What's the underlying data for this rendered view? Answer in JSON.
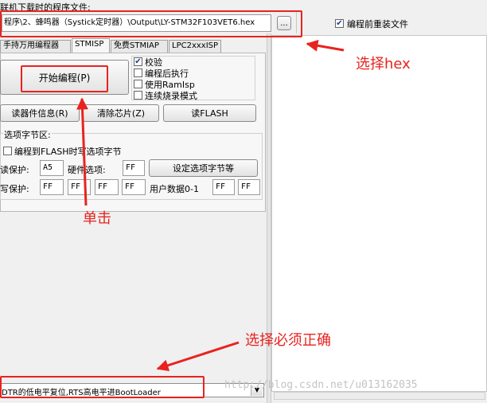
{
  "header": {
    "file_label": "联机下载时的程序文件:",
    "file_path": "程序\\2、蜂鸣器（Systick定时器）\\Output\\LY-STM32F103VET6.hex",
    "browse_label": "...",
    "reload_label": "编程前重装文件",
    "reload_checked": true
  },
  "tabs": [
    {
      "label": "手持万用编程器"
    },
    {
      "label": "STMISP"
    },
    {
      "label": "免费STMIAP"
    },
    {
      "label": "LPC2xxxISP"
    }
  ],
  "program": {
    "start_label": "开始编程(P)",
    "options": [
      {
        "label": "校验",
        "checked": true
      },
      {
        "label": "编程后执行",
        "checked": false
      },
      {
        "label": "使用RamIsp",
        "checked": false
      },
      {
        "label": "连续烧录模式",
        "checked": false
      }
    ]
  },
  "actions": {
    "read_info": "读器件信息(R)",
    "erase": "清除芯片(Z)",
    "read_flash": "读FLASH"
  },
  "option_bytes": {
    "group_label": "选项字节区:",
    "write_option_label": "编程到FLASH时写选项字节",
    "read_protect_label": "读保护:",
    "read_protect_value": "A5",
    "hw_option_label": "硬件选项:",
    "hw_option_value": "FF",
    "set_button": "设定选项字节等",
    "write_protect_label": "写保护:",
    "write_protect_values": [
      "FF",
      "FF",
      "FF",
      "FF"
    ],
    "user_data_label": "用户数据0-1",
    "user_data_values": [
      "FF",
      "FF"
    ]
  },
  "bootloader_select": "DTR的低电平复位,RTS高电平进BootLoader",
  "annotations": {
    "select_hex": "选择hex",
    "click": "单击",
    "must_be_correct": "选择必须正确"
  },
  "watermark": "http://blog.csdn.net/u013162035",
  "colors": {
    "annotation_red": "#e8231f"
  }
}
